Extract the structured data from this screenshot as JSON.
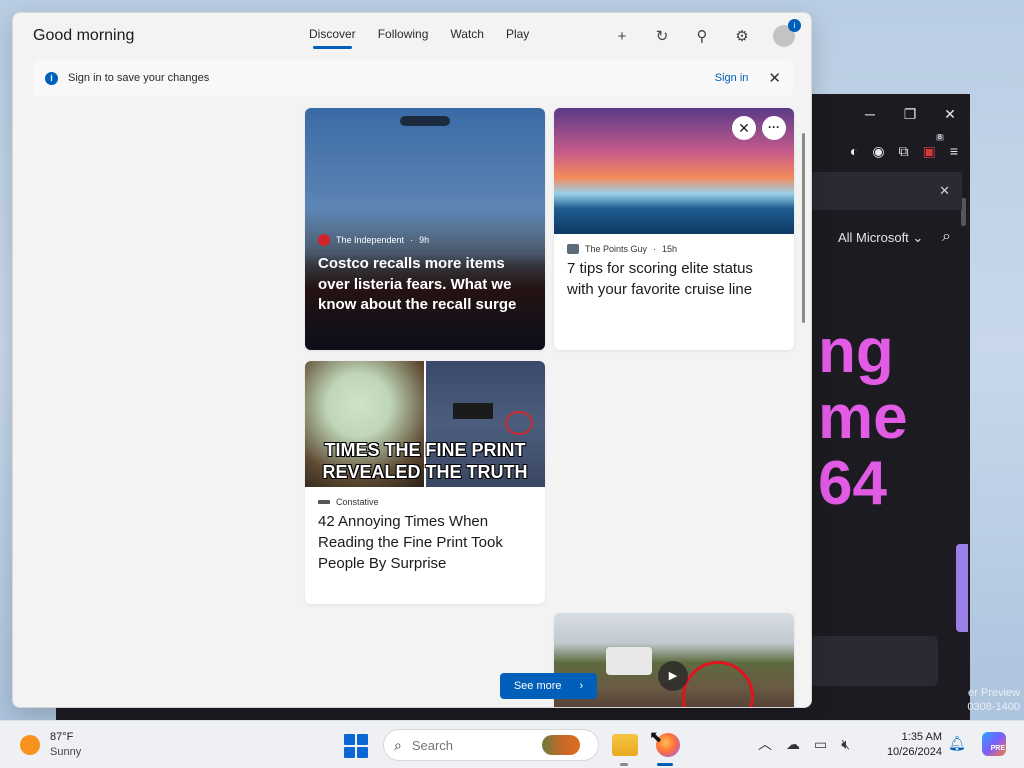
{
  "widgets": {
    "greeting": "Good morning",
    "tabs": [
      {
        "label": "Discover",
        "active": true
      },
      {
        "label": "Following",
        "active": false
      },
      {
        "label": "Watch",
        "active": false
      },
      {
        "label": "Play",
        "active": false
      }
    ],
    "top_icons": [
      "plus-icon",
      "refresh-icon",
      "pin-icon",
      "gear-icon",
      "profile-icon"
    ],
    "profile_badge": "i",
    "signin_bar": {
      "message": "Sign in to save your changes",
      "link": "Sign in"
    },
    "cards": [
      {
        "source": "The Independent",
        "age": "9h",
        "headline": "Costco recalls more items over listeria fears. What we know about the recall surge"
      },
      {
        "source": "The Points Guy",
        "age": "15h",
        "headline": "7 tips for scoring elite status with your favorite cruise line"
      },
      {
        "source": "Constative",
        "image_text": "TIMES THE FINE PRINT REVEALED THE TRUTH",
        "headline": "42 Annoying Times When Reading the Fine Print Took People By Surprise"
      },
      {
        "media": "video"
      }
    ],
    "see_more": "See more"
  },
  "background_window": {
    "filter_label": "All Microsoft",
    "hero_text": "ng\nme\n64",
    "extension_badge": "8",
    "watermark": "er Preview\n0308-1400"
  },
  "taskbar": {
    "weather": {
      "temp": "87°F",
      "condition": "Sunny"
    },
    "search_placeholder": "Search",
    "time": "1:35 AM",
    "date": "10/26/2024",
    "copilot_badge": "PRE"
  },
  "colors": {
    "accent": "#005fb8",
    "hero_text": "#e15be5",
    "recording_circle": "#e0141e"
  }
}
